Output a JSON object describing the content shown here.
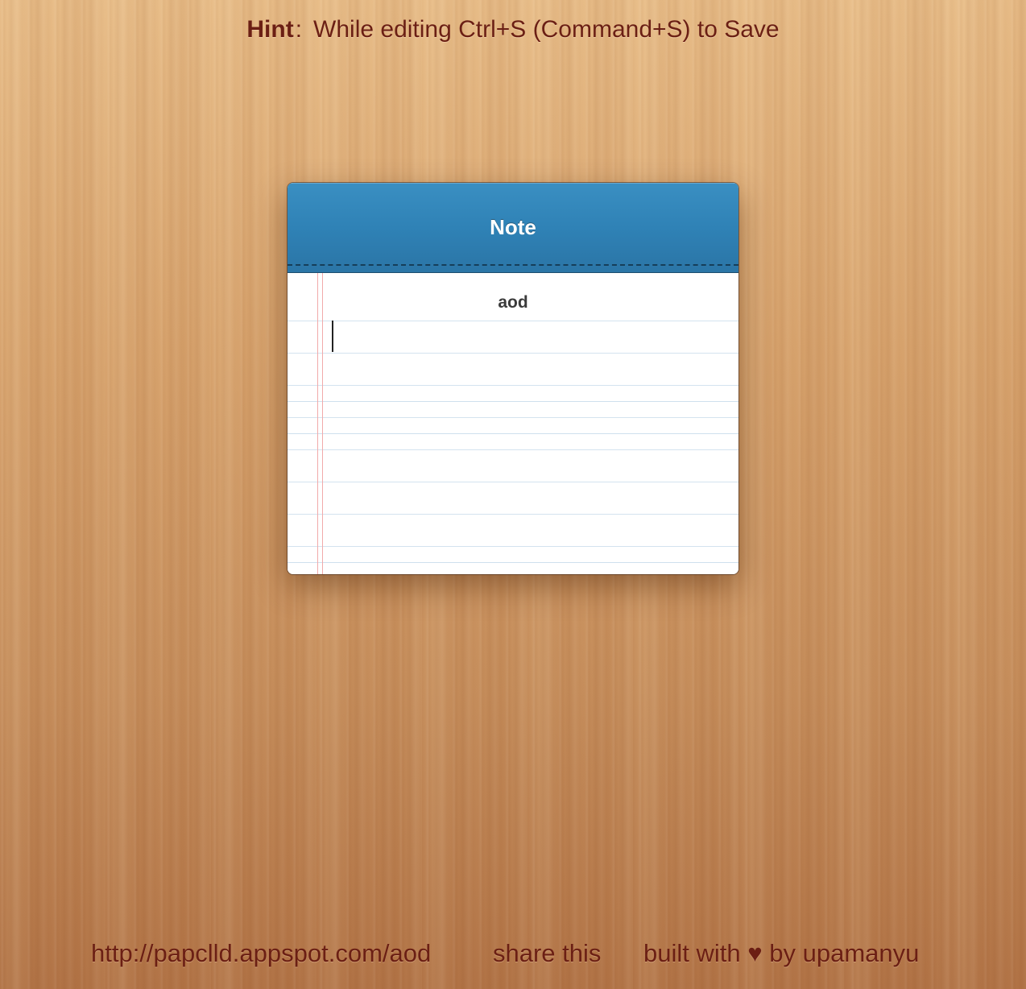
{
  "hint": {
    "label": "Hint",
    "separator": ":",
    "text": "While editing Ctrl+S (Command+S) to Save"
  },
  "note": {
    "title": "Note",
    "subject": "aod",
    "body": ""
  },
  "footer": {
    "url": "http://papclld.appspot.com/aod",
    "share": "share this",
    "credit": "built with ♥ by upamanyu"
  },
  "colors": {
    "header_blue": "#2f82b6",
    "text_brown": "#6b1f14",
    "margin_red": "#f2aaaa",
    "rule_blue": "#d4e3ef"
  }
}
